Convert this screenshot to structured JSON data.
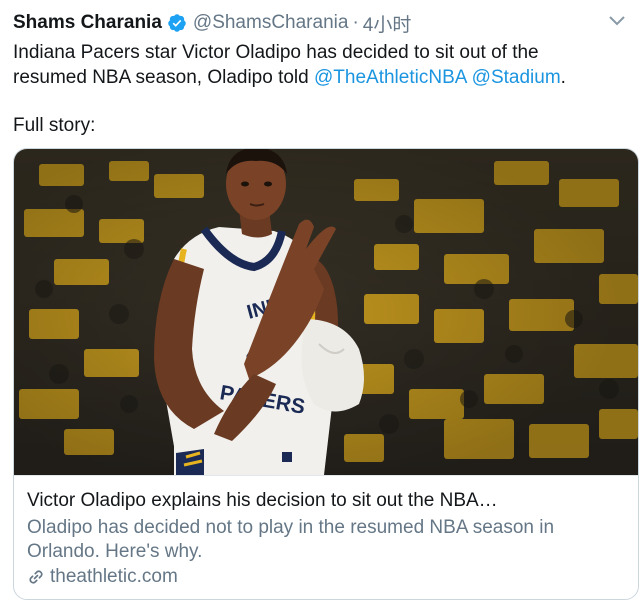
{
  "tweet": {
    "author_name": "Shams Charania",
    "handle": "@ShamsCharania",
    "separator": "·",
    "time": "4小时",
    "text_line1": "Indiana Pacers star Victor Oladipo has decided to sit out of the",
    "text_line2_plain": "resumed NBA season, Oladipo told ",
    "mention1": "@TheAthleticNBA",
    "mention2": "@Stadium",
    "text_end": ".",
    "full_story": "Full story:"
  },
  "card": {
    "image_jersey_text": "PACERS",
    "title": "Victor Oladipo explains his decision to sit out the NBA…",
    "description": "Oladipo has decided not to play in the resumed NBA season in Orlando. Here's why.",
    "domain": "theathletic.com"
  },
  "colors": {
    "link": "#1b95e0",
    "secondary": "#657786",
    "verified": "#1da1f2",
    "pacers_navy": "#1a2a55",
    "pacers_gold": "#e7b41f"
  },
  "icons": [
    "verified-badge-icon",
    "caret-down-icon",
    "link-icon"
  ]
}
